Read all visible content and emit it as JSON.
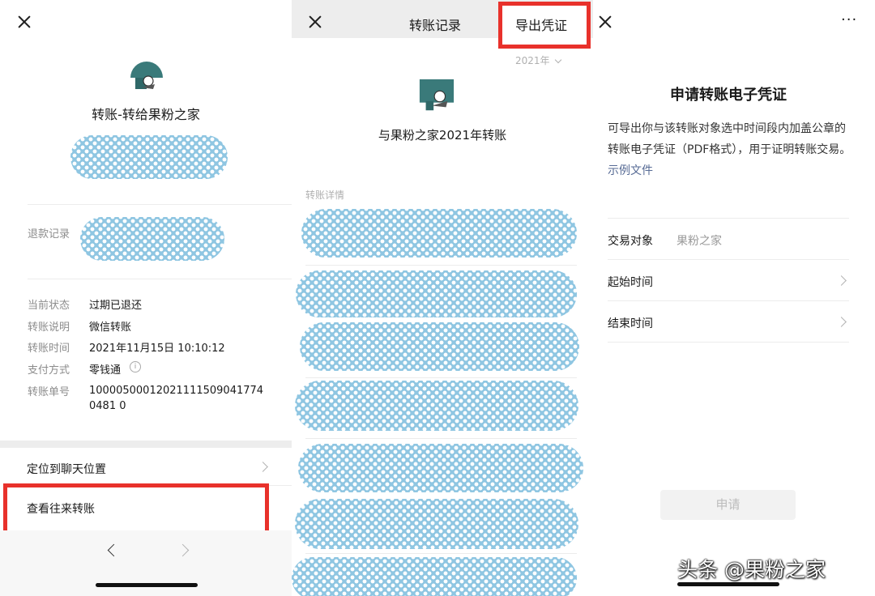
{
  "panel1": {
    "title": "转账-转给果粉之家",
    "refund_label": "退款记录",
    "details": [
      {
        "label": "当前状态",
        "value": "过期已退还"
      },
      {
        "label": "转账说明",
        "value": "微信转账"
      },
      {
        "label": "转账时间",
        "value": "2021年11月15日 10:10:12"
      },
      {
        "label": "支付方式",
        "value": "零钱通"
      },
      {
        "label": "转账单号",
        "value": "100005000120211115090417740481 0"
      }
    ],
    "locate_chat": "定位到聊天位置",
    "view_history": "查看往来转账"
  },
  "panel2": {
    "title": "转账记录",
    "export_button": "导出凭证",
    "year_filter": "2021年",
    "subtitle": "与果粉之家2021年转账",
    "section_label": "转账详情"
  },
  "panel3": {
    "more": "···",
    "heading": "申请转账电子凭证",
    "description": "可导出你与该转账对象选中时间段内加盖公章的转账电子凭证（PDF格式），用于证明转账交易。",
    "example_link": "示例文件",
    "fields": [
      {
        "label": "交易对象",
        "value": "果粉之家"
      },
      {
        "label": "起始时间",
        "value": ""
      },
      {
        "label": "结束时间",
        "value": ""
      }
    ],
    "apply_button": "申请"
  },
  "watermark": "头条 @果粉之家",
  "colors": {
    "highlight": "#e8312b",
    "link": "#576b95",
    "blob": "#8fc6e2",
    "avatar": "#3a7a7a"
  }
}
